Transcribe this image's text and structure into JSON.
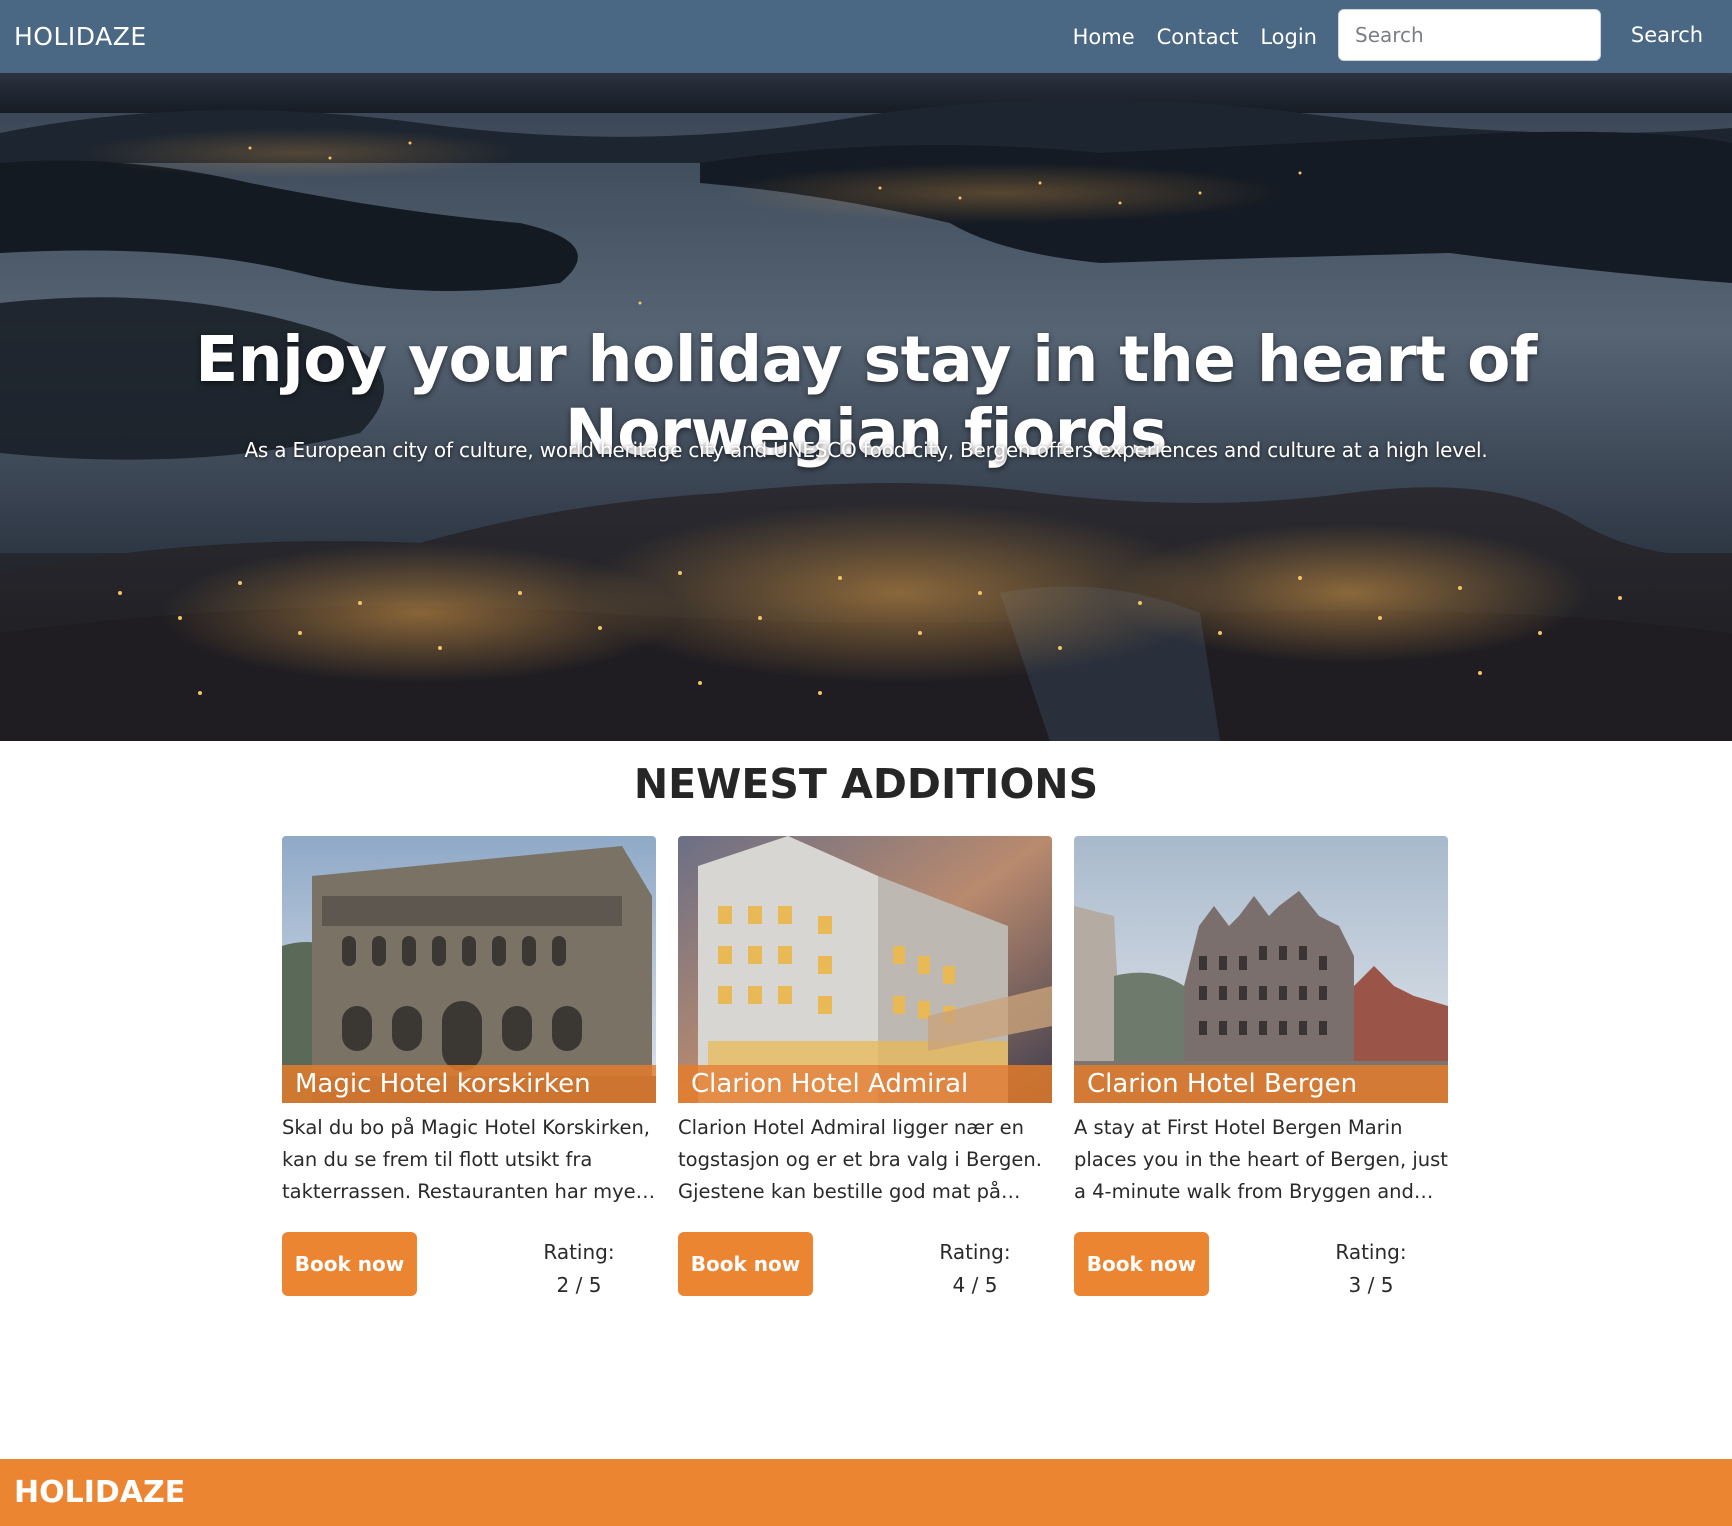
{
  "nav": {
    "brand": "HOLIDAZE",
    "links": [
      "Home",
      "Contact",
      "Login"
    ],
    "search_placeholder": "Search",
    "search_button": "Search"
  },
  "hero": {
    "title": "Enjoy your holiday stay in the heart of Norwegian fjords",
    "subtitle": "As a European city of culture, world heritage city and UNESCO food city, Bergen offers experiences and culture at a high level."
  },
  "newest": {
    "title": "NEWEST ADDITIONS",
    "cards": [
      {
        "name": "Magic Hotel korskirken",
        "description": "Skal du bo på Magic Hotel Korskirken, kan du se frem til flott utsikt fra takterrassen. Restauranten har mye…",
        "button": "Book now",
        "rating_label": "Rating:",
        "rating": "2 / 5"
      },
      {
        "name": "Clarion Hotel Admiral",
        "description": "Clarion Hotel Admiral ligger nær en togstasjon og er et bra valg i Bergen. Gjestene kan bestille god mat på…",
        "button": "Book now",
        "rating_label": "Rating:",
        "rating": "4 / 5"
      },
      {
        "name": "Clarion Hotel Bergen",
        "description": "A stay at First Hotel Bergen Marin places you in the heart of Bergen, just a 4-minute walk from Bryggen and…",
        "button": "Book now",
        "rating_label": "Rating:",
        "rating": "3 / 5"
      }
    ]
  },
  "footer": {
    "brand": "HOLIDAZE"
  },
  "colors": {
    "navbar": "#4a6784",
    "accent": "#ec8532",
    "text": "#2a2a2a"
  }
}
